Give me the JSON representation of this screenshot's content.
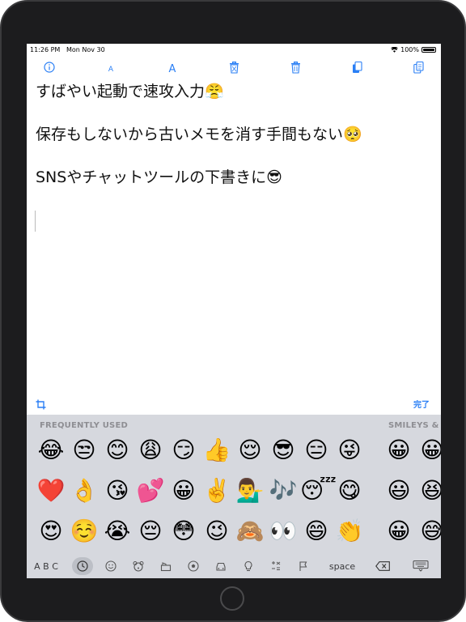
{
  "status": {
    "time": "11:26 PM",
    "date": "Mon Nov 30",
    "battery": "100%"
  },
  "toolbar": {
    "info_icon": "info-icon",
    "small_font_label": "A",
    "large_font_label": "A",
    "clear_icon": "trash-icon",
    "delete_icon": "trash-icon",
    "copy_icon": "copy-icon",
    "paste_icon": "paste-icon"
  },
  "editor": {
    "lines": [
      "すばやい起動で速攻入力😤",
      "保存もしないから古いメモを消す手間もない🥺",
      "SNSやチャットツールの下書きに😎"
    ]
  },
  "bottom": {
    "done_label": "完了"
  },
  "keyboard": {
    "section_frequent": "FREQUENTLY USED",
    "section_smileys": "SMILEYS &",
    "rows": [
      [
        "😂",
        "😒",
        "😊",
        "😩",
        "😏",
        "👍",
        "😌",
        "😎",
        "😑",
        "😜",
        "😀",
        "😀"
      ],
      [
        "❤️",
        "👌",
        "😘",
        "💕",
        "😀",
        "✌️",
        "💁‍♂️",
        "🎶",
        "😴",
        "😋",
        "😃",
        "😆"
      ],
      [
        "😍",
        "☺️",
        "😭",
        "😔",
        "😳",
        "😉",
        "🙈",
        "👀",
        "😄",
        "👏",
        "😀",
        "😅"
      ]
    ],
    "abc_label": "A B C",
    "space_label": "space"
  }
}
